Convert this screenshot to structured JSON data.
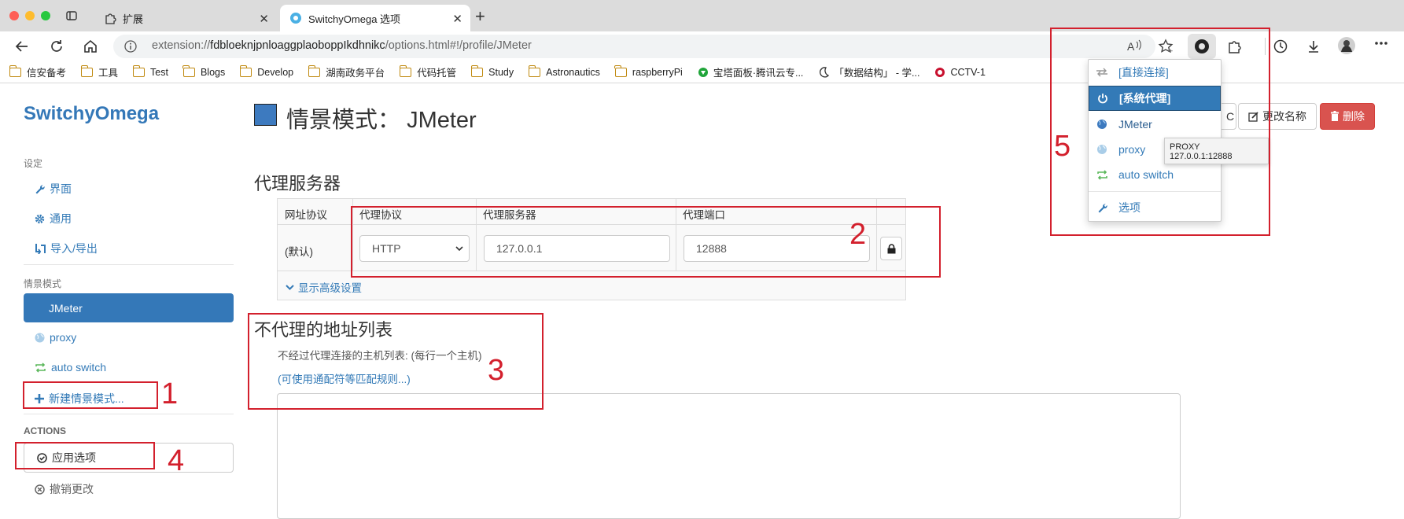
{
  "browser": {
    "tabs": [
      {
        "label": "扩展"
      },
      {
        "label": "SwitchyOmega 选项"
      }
    ],
    "url_prefix": "extension://",
    "url_host": "fdbloeknjpnloaggplaoboppIkdhnikc",
    "url_path": "/options.html#!/profile/JMeter",
    "bookmarks": [
      {
        "label": "信安备考",
        "icon": "folder-icon"
      },
      {
        "label": "工具",
        "icon": "folder-icon"
      },
      {
        "label": "Test",
        "icon": "folder-icon"
      },
      {
        "label": "Blogs",
        "icon": "folder-icon"
      },
      {
        "label": "Develop",
        "icon": "folder-icon"
      },
      {
        "label": "湖南政务平台",
        "icon": "folder-icon"
      },
      {
        "label": "代码托管",
        "icon": "folder-icon"
      },
      {
        "label": "Study",
        "icon": "folder-icon"
      },
      {
        "label": "Astronautics",
        "icon": "folder-icon"
      },
      {
        "label": "raspberryPi",
        "icon": "folder-icon"
      },
      {
        "label": "宝塔面板·腾讯云专...",
        "icon": "bt-panel-icon"
      },
      {
        "label": "「数据结构」 - 学...",
        "icon": "moon-site-icon"
      },
      {
        "label": "CCTV-1",
        "icon": "cctv-icon"
      }
    ]
  },
  "sidebar": {
    "brand": "SwitchyOmega",
    "settings_header": "设定",
    "settings_items": [
      {
        "label": "界面",
        "icon": "wrench-icon"
      },
      {
        "label": "通用",
        "icon": "gear-icon"
      },
      {
        "label": "导入/导出",
        "icon": "import-export-icon"
      }
    ],
    "profiles_header": "情景模式",
    "profiles": [
      {
        "label": "JMeter",
        "active": true
      },
      {
        "label": "proxy",
        "icon": "globe-icon"
      },
      {
        "label": "auto switch",
        "icon": "switch-icon"
      }
    ],
    "new_profile": "新建情景模式...",
    "actions_header": "ACTIONS",
    "apply": "应用选项",
    "discard": "撤销更改"
  },
  "main": {
    "profile_label": "情景模式：",
    "profile_name": "JMeter",
    "profile_color": "#3d7abf",
    "export_pac_visible": "C",
    "rename": "更改名称",
    "delete": "删除",
    "proxy_section": "代理服务器",
    "table_headers": [
      "网址协议",
      "代理协议",
      "代理服务器",
      "代理端口"
    ],
    "row_scheme": "(默认)",
    "protocol": "HTTP",
    "server": "127.0.0.1",
    "port": "12888",
    "show_advanced": "显示高级设置",
    "bypass_section": "不代理的地址列表",
    "bypass_desc": "不经过代理连接的主机列表: (每行一个主机)",
    "bypass_link": "(可使用通配符等匹配规则...)"
  },
  "popup": {
    "items": [
      {
        "label": "[直接连接]",
        "icon": "direct-icon"
      },
      {
        "label": "[系统代理]",
        "icon": "power-icon",
        "selected": true
      },
      {
        "label": "JMeter",
        "icon": "globe-icon"
      },
      {
        "label": "proxy",
        "icon": "globe-icon"
      },
      {
        "label": "auto switch",
        "icon": "switch-icon"
      },
      {
        "label": "选项",
        "icon": "wrench-icon"
      }
    ],
    "tooltip": "PROXY 127.0.0.1:12888"
  },
  "annotations": [
    "1",
    "2",
    "3",
    "4",
    "5"
  ],
  "colors": {
    "accent": "#337ab7",
    "danger": "#d9534f",
    "annotation": "#d3202d"
  }
}
